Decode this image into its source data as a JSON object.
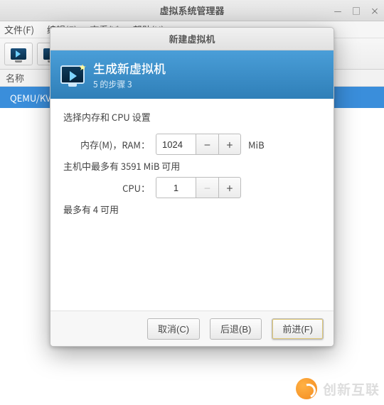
{
  "main_window": {
    "title": "虚拟系统管理器",
    "controls": {
      "min": "—",
      "max": "□",
      "close": "×"
    },
    "menu": {
      "file": "文件(F)",
      "edit": "编辑(E)",
      "view": "查看(V)",
      "help": "帮助(H)"
    },
    "list": {
      "header_name": "名称",
      "row0": "QEMU/KV"
    }
  },
  "dialog": {
    "window_title": "新建虚拟机",
    "banner_title": "生成新虚拟机",
    "banner_step": "5 的步骤 3",
    "section_label": "选择内存和 CPU 设置",
    "memory": {
      "label": "内存(M)，RAM：",
      "value": "1024",
      "unit": "MiB",
      "hint": "主机中最多有 3591 MiB 可用"
    },
    "cpu": {
      "label": "CPU：",
      "value": "1",
      "hint": "最多有 4 可用"
    },
    "buttons": {
      "cancel": "取消(C)",
      "back": "后退(B)",
      "forward": "前进(F)"
    }
  },
  "watermark": {
    "text": "创新互联"
  }
}
